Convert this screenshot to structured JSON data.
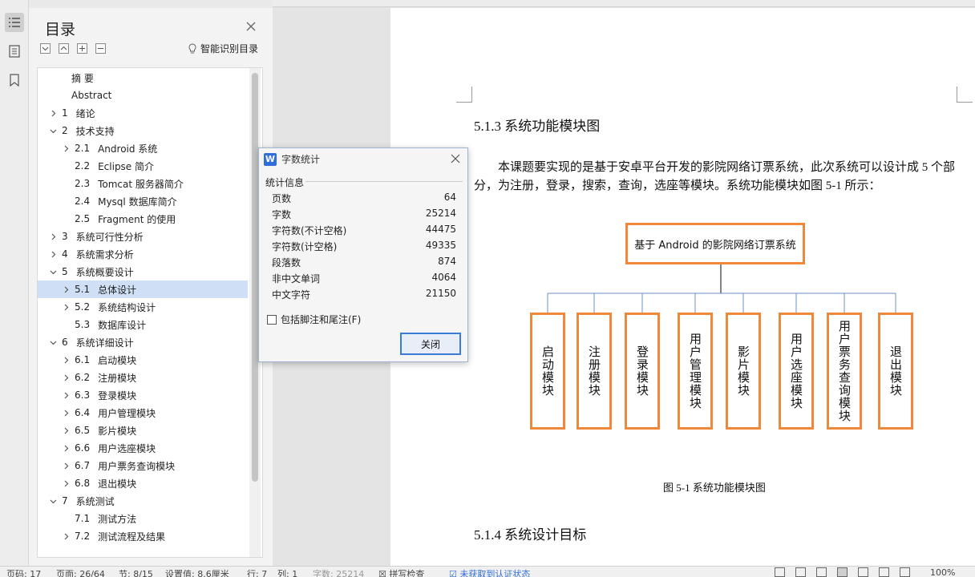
{
  "toc": {
    "title": "目录",
    "smart_label": "智能识别目录",
    "items": [
      {
        "label": "摘  要"
      },
      {
        "label": "Abstract"
      },
      {
        "num": "1",
        "label": "绪论",
        "arrow": "right"
      },
      {
        "num": "2",
        "label": "技术支持",
        "arrow": "down"
      },
      {
        "num": "2.1",
        "label": "Android 系统",
        "arrow": "right"
      },
      {
        "num": "2.2",
        "label": "Eclipse 简介"
      },
      {
        "num": "2.3",
        "label": "Tomcat 服务器简介"
      },
      {
        "num": "2.4",
        "label": "Mysql 数据库简介"
      },
      {
        "num": "2.5",
        "label": "Fragment 的使用"
      },
      {
        "num": "3",
        "label": "系统可行性分析",
        "arrow": "right"
      },
      {
        "num": "4",
        "label": "系统需求分析",
        "arrow": "right"
      },
      {
        "num": "5",
        "label": "系统概要设计",
        "arrow": "down"
      },
      {
        "num": "5.1",
        "label": "总体设计",
        "arrow": "right",
        "selected": true
      },
      {
        "num": "5.2",
        "label": "系统结构设计",
        "arrow": "right"
      },
      {
        "num": "5.3",
        "label": "数据库设计"
      },
      {
        "num": "6",
        "label": "系统详细设计",
        "arrow": "down"
      },
      {
        "num": "6.1",
        "label": "启动模块",
        "arrow": "right"
      },
      {
        "num": "6.2",
        "label": "注册模块",
        "arrow": "right"
      },
      {
        "num": "6.3",
        "label": "登录模块",
        "arrow": "right"
      },
      {
        "num": "6.4",
        "label": "用户管理模块",
        "arrow": "right"
      },
      {
        "num": "6.5",
        "label": "影片模块",
        "arrow": "right"
      },
      {
        "num": "6.6",
        "label": "用户选座模块",
        "arrow": "right"
      },
      {
        "num": "6.7",
        "label": "用户票务查询模块",
        "arrow": "right"
      },
      {
        "num": "6.8",
        "label": "退出模块",
        "arrow": "right"
      },
      {
        "num": "7",
        "label": "系统测试",
        "arrow": "down"
      },
      {
        "num": "7.1",
        "label": "测试方法"
      },
      {
        "num": "7.2",
        "label": "测试流程及结果",
        "arrow": "right"
      }
    ]
  },
  "document": {
    "heading1": "5.1.3    系统功能模块图",
    "paragraph": "本课题要实现的是基于安卓平台开发的影院网络订票系统，此次系统可以设计成 5 个部分，为注册，登录，搜索，查询，选座等模块。系统功能模块如图 5-1 所示：",
    "diagram_root": "基于 Android 的影院网络订票系统",
    "modules": [
      "启动模块",
      "注册模块",
      "登录模块",
      "用户管理模块",
      "影片模块",
      "用户选座模块",
      "用户票务查询模块",
      "退出模块"
    ],
    "caption": "图 5-1    系统功能模块图",
    "heading2": "5.1.4    系统设计目标"
  },
  "dialog": {
    "title": "字数统计",
    "section": "统计信息",
    "stats": [
      {
        "label": "页数",
        "value": "64"
      },
      {
        "label": "字数",
        "value": "25214"
      },
      {
        "label": "字符数(不计空格)",
        "value": "44475"
      },
      {
        "label": "字符数(计空格)",
        "value": "49335"
      },
      {
        "label": "段落数",
        "value": "874"
      },
      {
        "label": "非中文单词",
        "value": "4064"
      },
      {
        "label": "中文字符",
        "value": "21150"
      }
    ],
    "checkbox_label": "包括脚注和尾注(F)",
    "close_label": "关闭"
  },
  "status": {
    "row": "页码: 17",
    "page": "页面: 26/64",
    "section": "节: 8/15",
    "setting": "设置值: 8.6厘米",
    "line": "行: 7",
    "col": "列: 1",
    "words": "字数: 25214",
    "spell": "拼写检查",
    "auth": "未获取到认证状态",
    "zoom": "100%"
  },
  "colors": {
    "accent": "#f0883a",
    "selection": "#cfe0f6",
    "dialog_border": "#3a7bd5"
  }
}
